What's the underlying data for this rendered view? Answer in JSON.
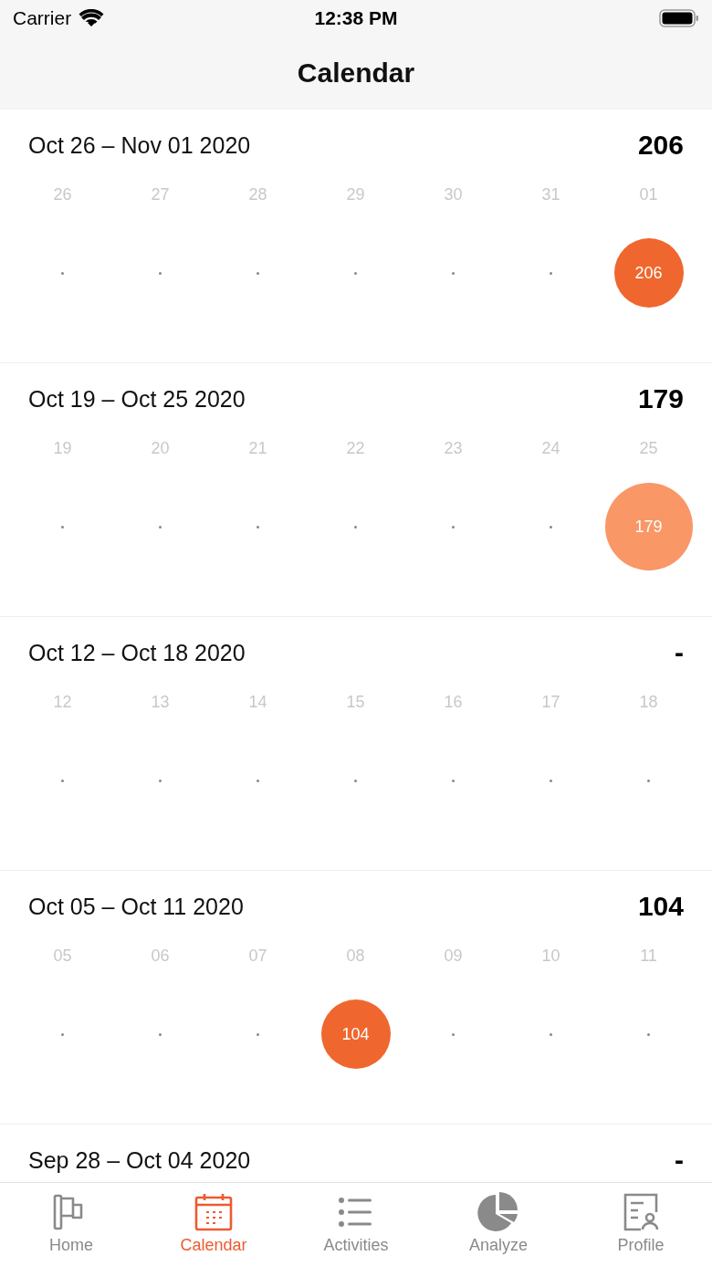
{
  "status_bar": {
    "carrier": "Carrier",
    "time": "12:38 PM"
  },
  "nav": {
    "title": "Calendar"
  },
  "weeks": [
    {
      "range": "Oct 26 – Nov 01 2020",
      "total": "206",
      "days": [
        {
          "label": "26"
        },
        {
          "label": "27"
        },
        {
          "label": "28"
        },
        {
          "label": "29"
        },
        {
          "label": "30"
        },
        {
          "label": "31"
        },
        {
          "label": "01",
          "bubble": {
            "value": "206",
            "color": "#ef672e",
            "kind": "normal"
          }
        }
      ]
    },
    {
      "range": "Oct 19 – Oct 25 2020",
      "total": "179",
      "days": [
        {
          "label": "19"
        },
        {
          "label": "20"
        },
        {
          "label": "21"
        },
        {
          "label": "22"
        },
        {
          "label": "23"
        },
        {
          "label": "24"
        },
        {
          "label": "25",
          "bubble": {
            "value": "179",
            "color": "#f99766",
            "kind": "large"
          }
        }
      ]
    },
    {
      "range": "Oct 12 – Oct 18 2020",
      "total": "-",
      "days": [
        {
          "label": "12"
        },
        {
          "label": "13"
        },
        {
          "label": "14"
        },
        {
          "label": "15"
        },
        {
          "label": "16"
        },
        {
          "label": "17"
        },
        {
          "label": "18"
        }
      ]
    },
    {
      "range": "Oct 05 – Oct 11 2020",
      "total": "104",
      "days": [
        {
          "label": "05"
        },
        {
          "label": "06"
        },
        {
          "label": "07"
        },
        {
          "label": "08",
          "bubble": {
            "value": "104",
            "color": "#ef672e",
            "kind": "normal"
          }
        },
        {
          "label": "09"
        },
        {
          "label": "10"
        },
        {
          "label": "11"
        }
      ]
    },
    {
      "range": "Sep 28 – Oct 04 2020",
      "total": "-"
    }
  ],
  "tabs": [
    {
      "label": "Home",
      "kind": "flag",
      "selected": false
    },
    {
      "label": "Calendar",
      "kind": "calendar",
      "selected": true
    },
    {
      "label": "Activities",
      "kind": "list",
      "selected": false
    },
    {
      "label": "Analyze",
      "kind": "pie",
      "selected": false
    },
    {
      "label": "Profile",
      "kind": "profile",
      "selected": false
    }
  ]
}
